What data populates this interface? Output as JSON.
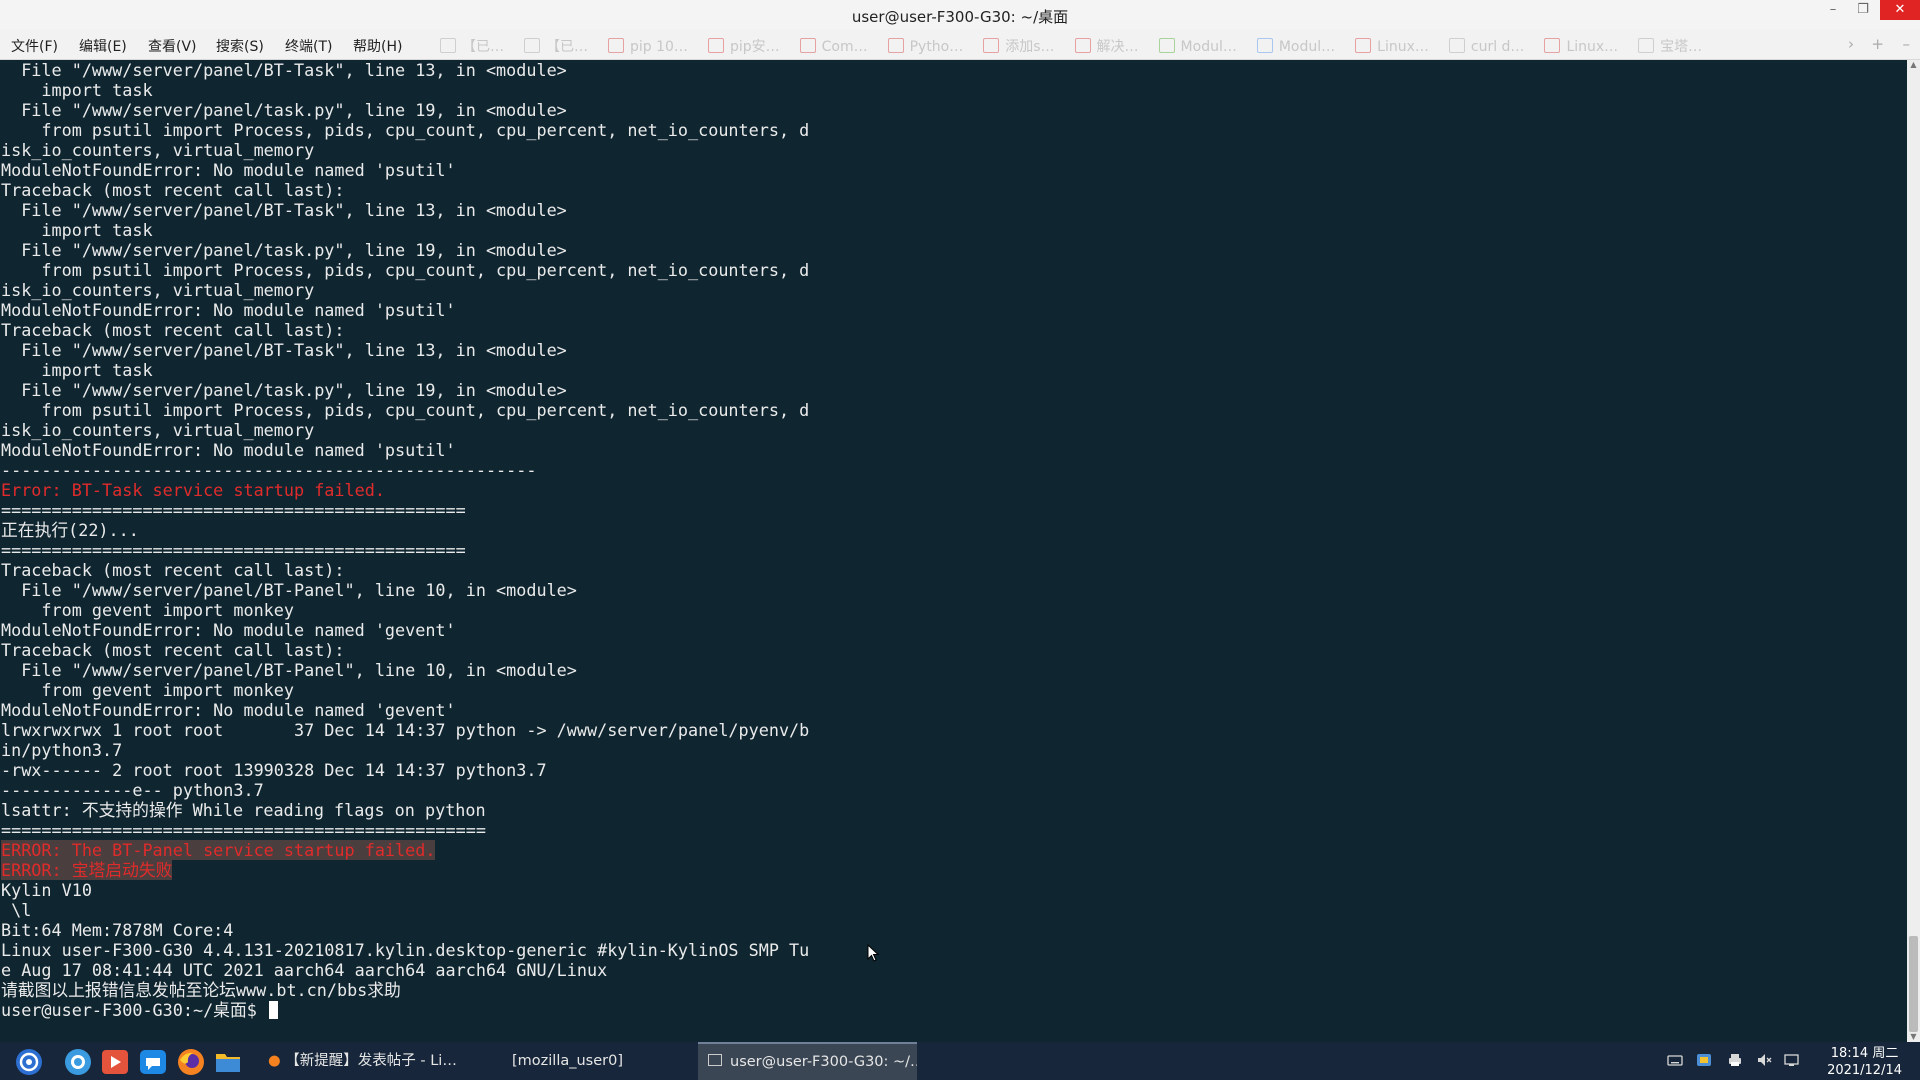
{
  "window": {
    "title": "user@user-F300-G30: ~/桌面"
  },
  "menu": [
    "文件(F)",
    "编辑(E)",
    "查看(V)",
    "搜索(S)",
    "终端(T)",
    "帮助(H)"
  ],
  "bookmarks": [
    {
      "label": "【已…",
      "color": "gray"
    },
    {
      "label": "【已…",
      "color": "gray"
    },
    {
      "label": "pip 10…",
      "color": "red"
    },
    {
      "label": "pip安…",
      "color": "red"
    },
    {
      "label": "Com…",
      "color": "red"
    },
    {
      "label": "Pytho…",
      "color": "red"
    },
    {
      "label": "添加s…",
      "color": "red"
    },
    {
      "label": "解决…",
      "color": "red"
    },
    {
      "label": "Modul…",
      "color": "green"
    },
    {
      "label": "Modul…",
      "color": "blue"
    },
    {
      "label": "Linux…",
      "color": "red"
    },
    {
      "label": "curl d…",
      "color": "gray"
    },
    {
      "label": "Linux…",
      "color": "red"
    },
    {
      "label": "宝塔…",
      "color": "gray"
    }
  ],
  "terminal": {
    "lines": [
      {
        "text": "  File \"/www/server/panel/BT-Task\", line 13, in <module>"
      },
      {
        "text": "    import task"
      },
      {
        "text": "  File \"/www/server/panel/task.py\", line 19, in <module>"
      },
      {
        "text": "    from psutil import Process, pids, cpu_count, cpu_percent, net_io_counters, d"
      },
      {
        "text": "isk_io_counters, virtual_memory"
      },
      {
        "text": "ModuleNotFoundError: No module named 'psutil'"
      },
      {
        "text": "Traceback (most recent call last):"
      },
      {
        "text": "  File \"/www/server/panel/BT-Task\", line 13, in <module>"
      },
      {
        "text": "    import task"
      },
      {
        "text": "  File \"/www/server/panel/task.py\", line 19, in <module>"
      },
      {
        "text": "    from psutil import Process, pids, cpu_count, cpu_percent, net_io_counters, d"
      },
      {
        "text": "isk_io_counters, virtual_memory"
      },
      {
        "text": "ModuleNotFoundError: No module named 'psutil'"
      },
      {
        "text": "Traceback (most recent call last):"
      },
      {
        "text": "  File \"/www/server/panel/BT-Task\", line 13, in <module>"
      },
      {
        "text": "    import task"
      },
      {
        "text": "  File \"/www/server/panel/task.py\", line 19, in <module>"
      },
      {
        "text": "    from psutil import Process, pids, cpu_count, cpu_percent, net_io_counters, d"
      },
      {
        "text": "isk_io_counters, virtual_memory"
      },
      {
        "text": "ModuleNotFoundError: No module named 'psutil'"
      },
      {
        "text": "-----------------------------------------------------"
      },
      {
        "text": "Error: BT-Task service startup failed.",
        "style": "red"
      },
      {
        "text": "=============================================="
      },
      {
        "text": "正在执行(22)..."
      },
      {
        "text": "=============================================="
      },
      {
        "text": "Traceback (most recent call last):"
      },
      {
        "text": "  File \"/www/server/panel/BT-Panel\", line 10, in <module>"
      },
      {
        "text": "    from gevent import monkey"
      },
      {
        "text": "ModuleNotFoundError: No module named 'gevent'"
      },
      {
        "text": "Traceback (most recent call last):"
      },
      {
        "text": "  File \"/www/server/panel/BT-Panel\", line 10, in <module>"
      },
      {
        "text": "    from gevent import monkey"
      },
      {
        "text": "ModuleNotFoundError: No module named 'gevent'"
      },
      {
        "text": "lrwxrwxrwx 1 root root       37 Dec 14 14:37 python -> /www/server/panel/pyenv/b"
      },
      {
        "text": "in/python3.7"
      },
      {
        "text": "-rwx------ 2 root root 13990328 Dec 14 14:37 python3.7"
      },
      {
        "text": "-------------e-- python3.7"
      },
      {
        "text": "lsattr: 不支持的操作 While reading flags on python"
      },
      {
        "text": "================================================"
      },
      {
        "text": "ERROR: The BT-Panel service startup failed.",
        "style": "red-hl"
      },
      {
        "text": "ERROR: 宝塔启动失败",
        "style": "red-hl"
      },
      {
        "text": "Kylin V10"
      },
      {
        "text": " \\l"
      },
      {
        "text": "Bit:64 Mem:7878M Core:4"
      },
      {
        "text": "Linux user-F300-G30 4.4.131-20210817.kylin.desktop-generic #kylin-KylinOS SMP Tu"
      },
      {
        "text": "e Aug 17 08:41:44 UTC 2021 aarch64 aarch64 aarch64 GNU/Linux"
      },
      {
        "text": "请截图以上报错信息发帖至论坛www.bt.cn/bbs求助"
      }
    ],
    "prompt": "user@user-F300-G30:~/桌面$ "
  },
  "taskbar": {
    "tasks": [
      {
        "label": "【新提醒】发表帖子 - Li…",
        "active": false
      },
      {
        "label": "[mozilla_user0]",
        "active": false
      },
      {
        "label": "user@user-F300-G30: ~/…",
        "active": true
      }
    ],
    "clock": {
      "time": "18:14 周二",
      "date": "2021/12/14"
    }
  }
}
